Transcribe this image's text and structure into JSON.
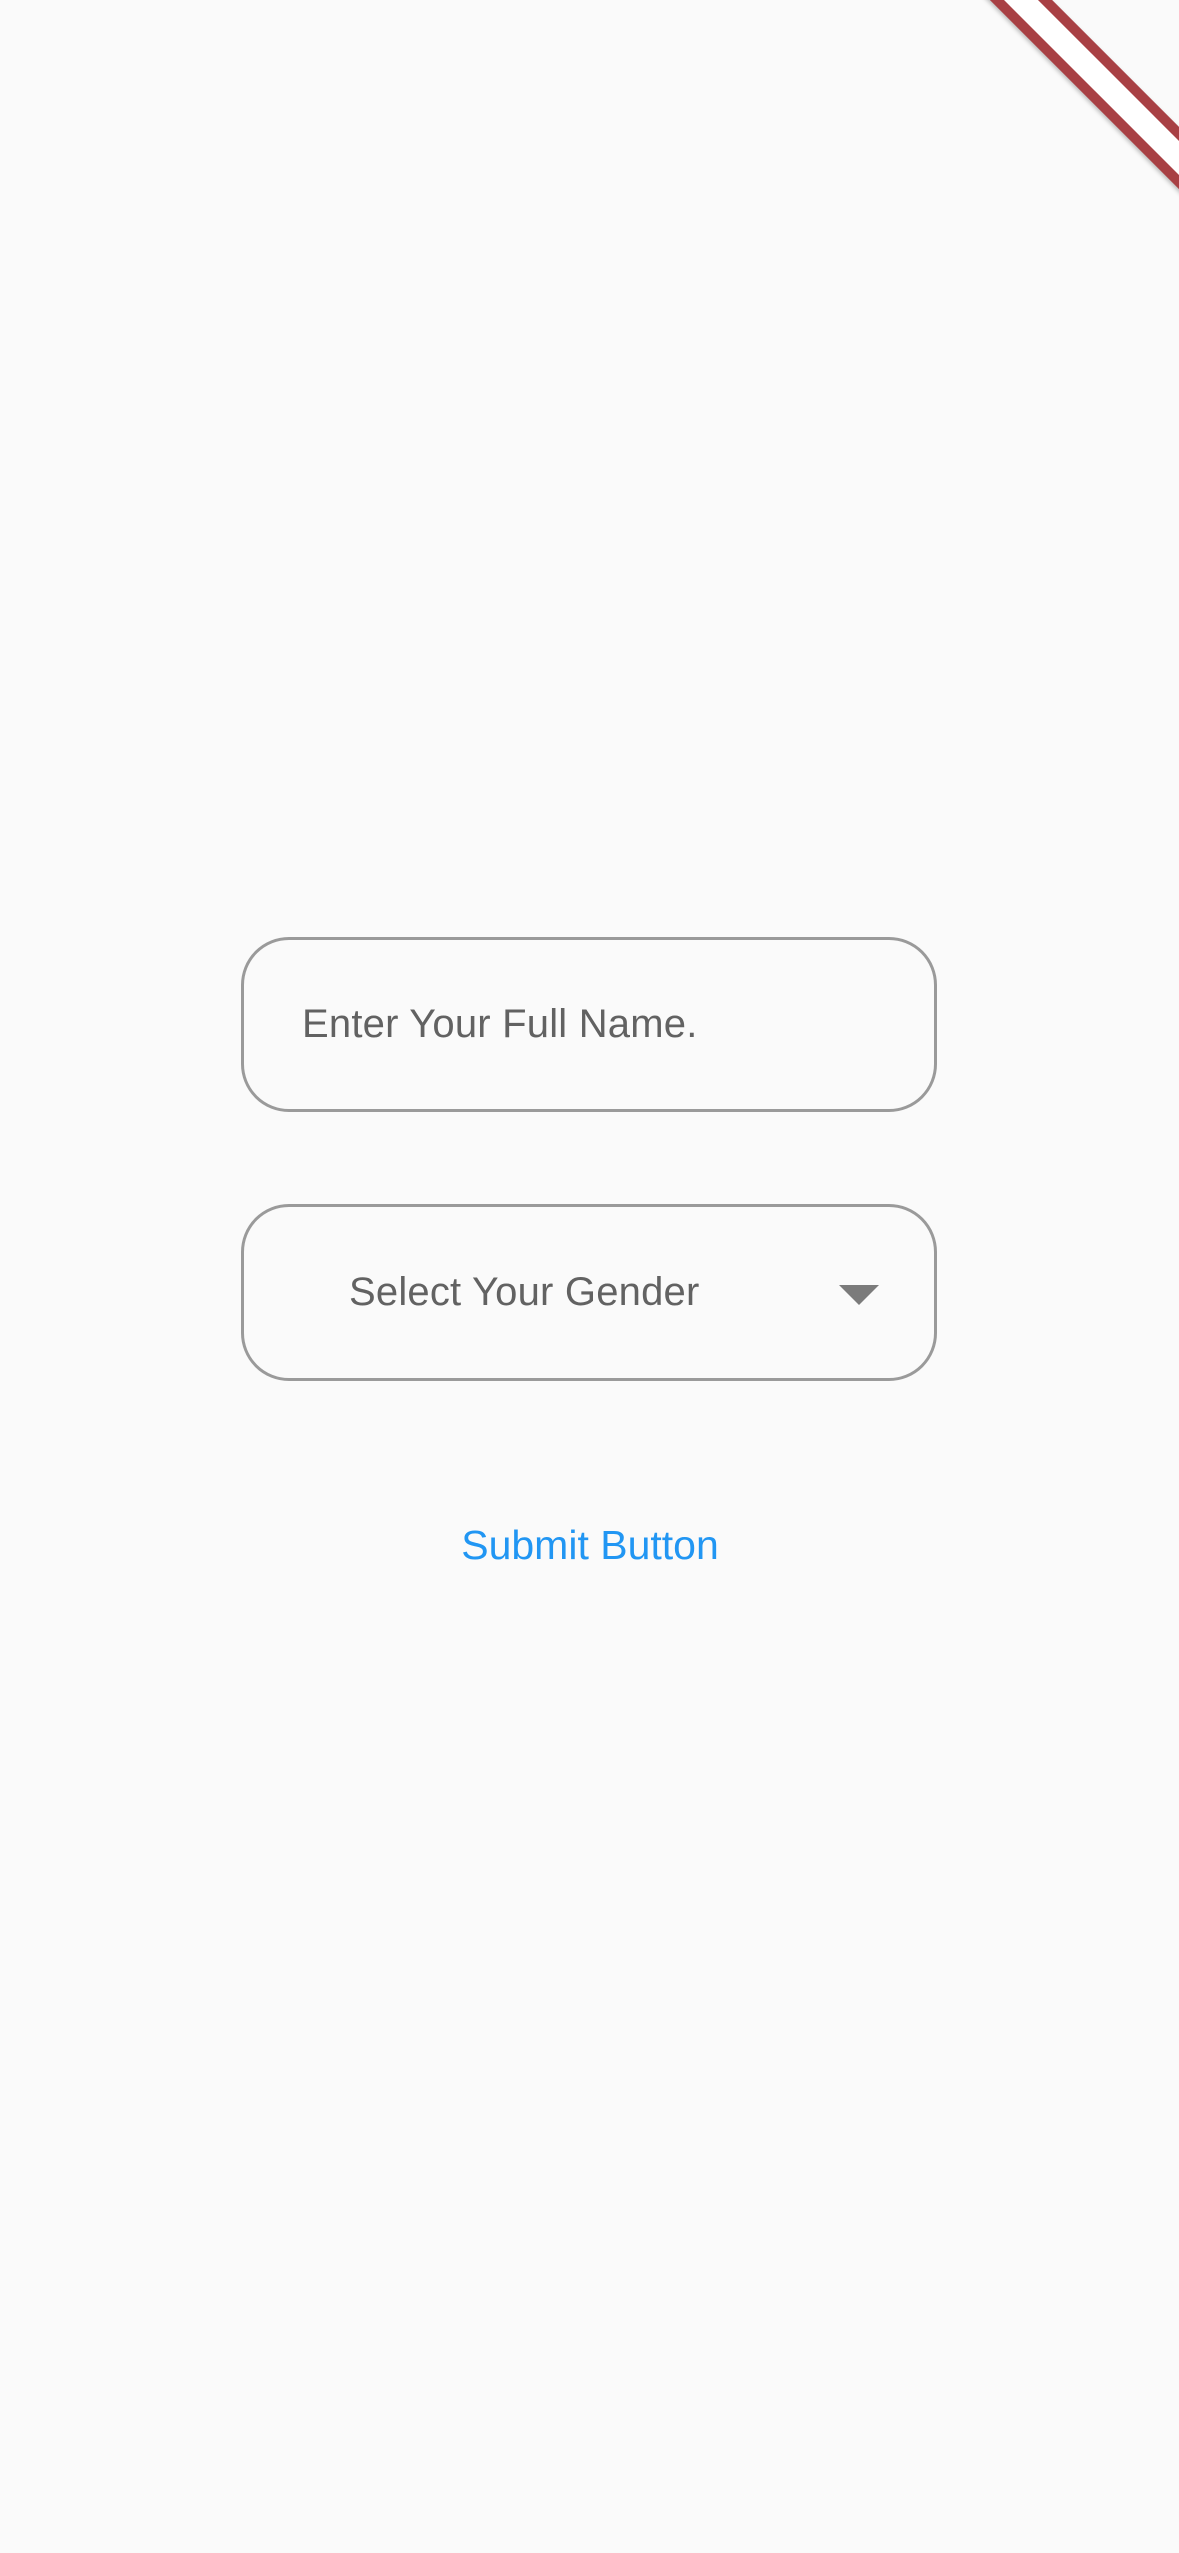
{
  "form": {
    "name_field": {
      "placeholder": "Enter Your Full Name.",
      "value": ""
    },
    "gender_dropdown": {
      "selected_label": "Select Your Gender",
      "icon": "arrow-drop-down-icon"
    },
    "submit_label": "Submit Button"
  },
  "debug_banner": {
    "icon": "debug-banner"
  },
  "colors": {
    "background": "#fafafa",
    "field_border": "#9a9a9a",
    "placeholder_text": "#626262",
    "accent": "#2196f3",
    "banner": "#a84044"
  }
}
